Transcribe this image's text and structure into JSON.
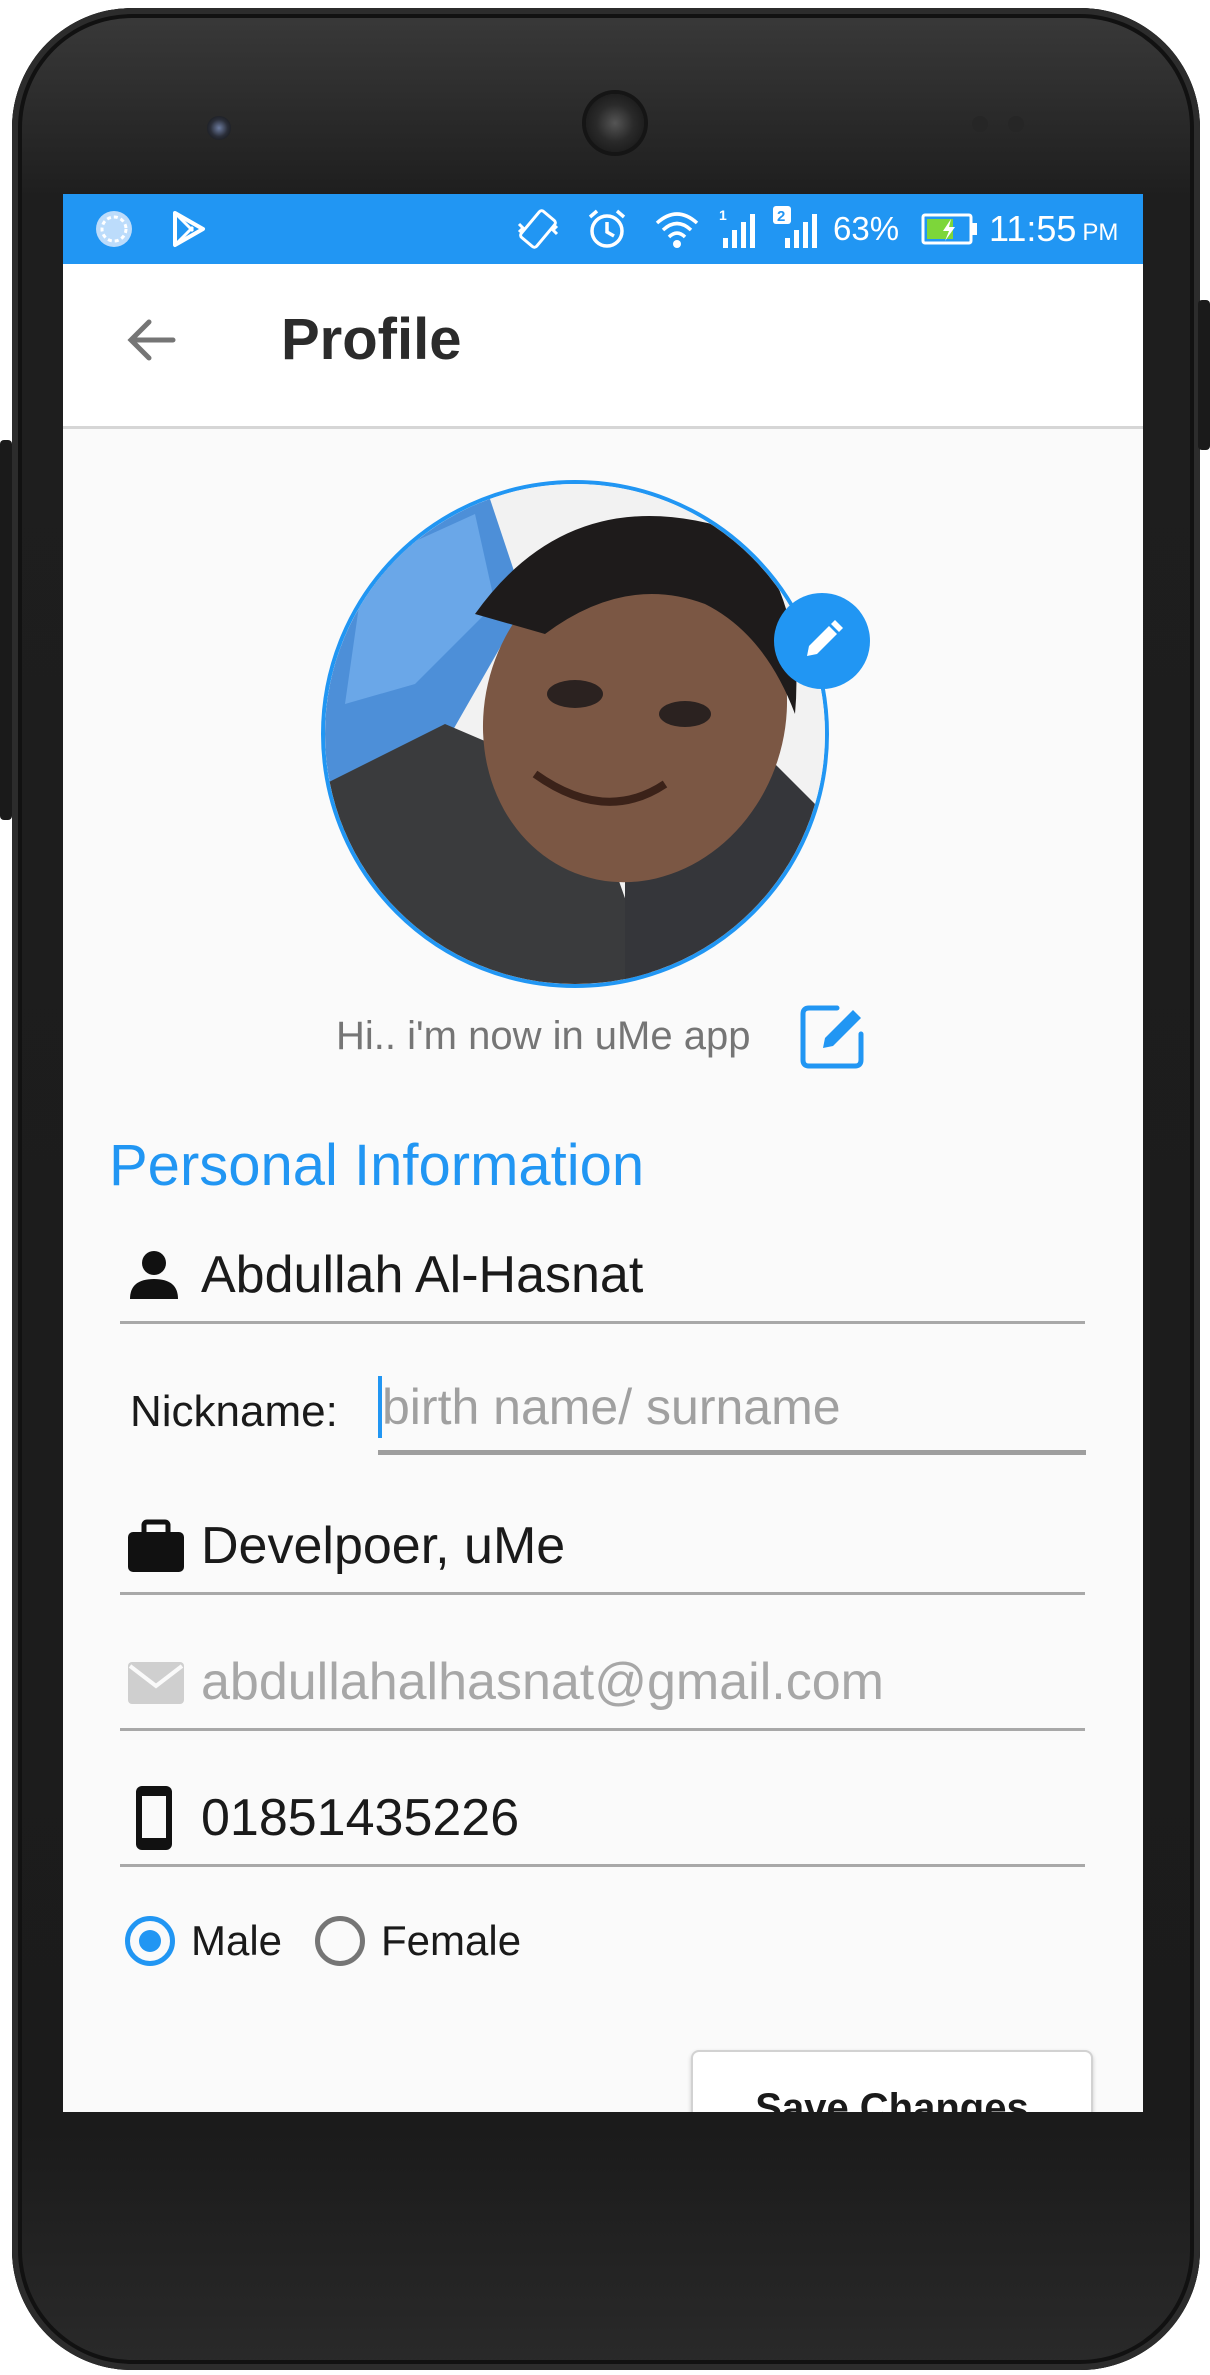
{
  "status_bar": {
    "battery_percent": "63%",
    "time": "11:55",
    "ampm": "PM",
    "sim1_label": "1",
    "sim2_label": "2"
  },
  "app_bar": {
    "title": "Profile"
  },
  "profile": {
    "status_message": "Hi.. i'm now in uMe app"
  },
  "personal_info": {
    "section_title": "Personal Information",
    "name": "Abdullah Al-Hasnat",
    "nickname_label": "Nickname:",
    "nickname_placeholder": "birth name/ surname",
    "occupation": "Develpoer, uMe",
    "email": "abdullahalhasnat@gmail.com",
    "phone": "01851435226"
  },
  "gender": {
    "options": [
      "Male",
      "Female"
    ],
    "selected": "Male"
  },
  "actions": {
    "save_label": "Save Changes"
  },
  "colors": {
    "accent": "#2196f3",
    "background": "#fafafa"
  }
}
